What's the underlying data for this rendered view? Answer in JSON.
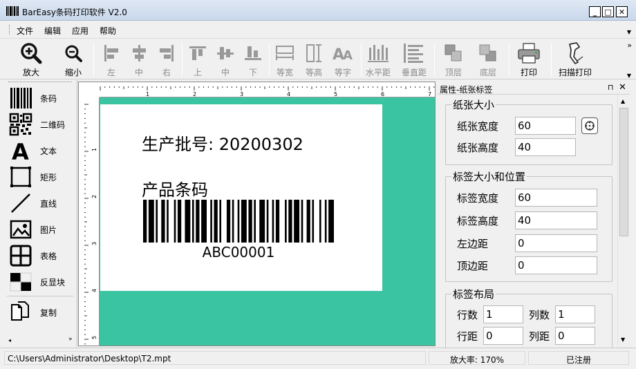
{
  "window": {
    "title": "BarEasy条码打印软件 V2.0",
    "minimize": "_",
    "maximize": "□",
    "close": "✕"
  },
  "menu": [
    {
      "label": "文件"
    },
    {
      "label": "编辑"
    },
    {
      "label": "应用"
    },
    {
      "label": "帮助"
    }
  ],
  "toolbar": {
    "zoom_in": "放大",
    "zoom_out": "缩小",
    "align_left": "左",
    "align_hcenter": "中",
    "align_right": "右",
    "align_top": "上",
    "align_vcenter": "中",
    "align_bottom": "下",
    "same_width": "等宽",
    "same_height": "等高",
    "same_font": "等字",
    "h_spacing": "水平距",
    "v_spacing": "垂直距",
    "to_top": "顶层",
    "to_bottom": "底层",
    "print": "打印",
    "scan_print": "扫描打印",
    "more": "»"
  },
  "tools": {
    "barcode": "条码",
    "qrcode": "二维码",
    "text": "文本",
    "rect": "矩形",
    "line": "直线",
    "image": "图片",
    "table": "表格",
    "inverse": "反显块",
    "copy": "复制"
  },
  "ruler": {
    "top_ticks": [
      "1",
      "2",
      "3",
      "4",
      "5",
      "6",
      "7"
    ],
    "left_ticks": [
      "1",
      "2",
      "3",
      "4",
      "5"
    ]
  },
  "label": {
    "text1": "生产批号: 20200302",
    "text2": "产品条码",
    "barcode_value": "ABC00001"
  },
  "props": {
    "title": "属性-纸张标签",
    "pin": "⊓",
    "close": "✕",
    "paper": {
      "title": "纸张大小",
      "width_label": "纸张宽度",
      "width_value": "60",
      "height_label": "纸张高度",
      "height_value": "40"
    },
    "labelsize": {
      "title": "标签大小和位置",
      "width_label": "标签宽度",
      "width_value": "60",
      "height_label": "标签高度",
      "height_value": "40",
      "left_label": "左边距",
      "left_value": "0",
      "top_label": "顶边距",
      "top_value": "0"
    },
    "layout": {
      "title": "标签布局",
      "rows_label": "行数",
      "rows_value": "1",
      "cols_label": "列数",
      "cols_value": "1",
      "rowgap_label": "行距",
      "rowgap_value": "0",
      "colgap_label": "列距",
      "colgap_value": "0"
    }
  },
  "status": {
    "path": "C:\\Users\\Administrator\\Desktop\\T2.mpt",
    "zoom": "放大率: 170%",
    "registration": "已注册"
  }
}
